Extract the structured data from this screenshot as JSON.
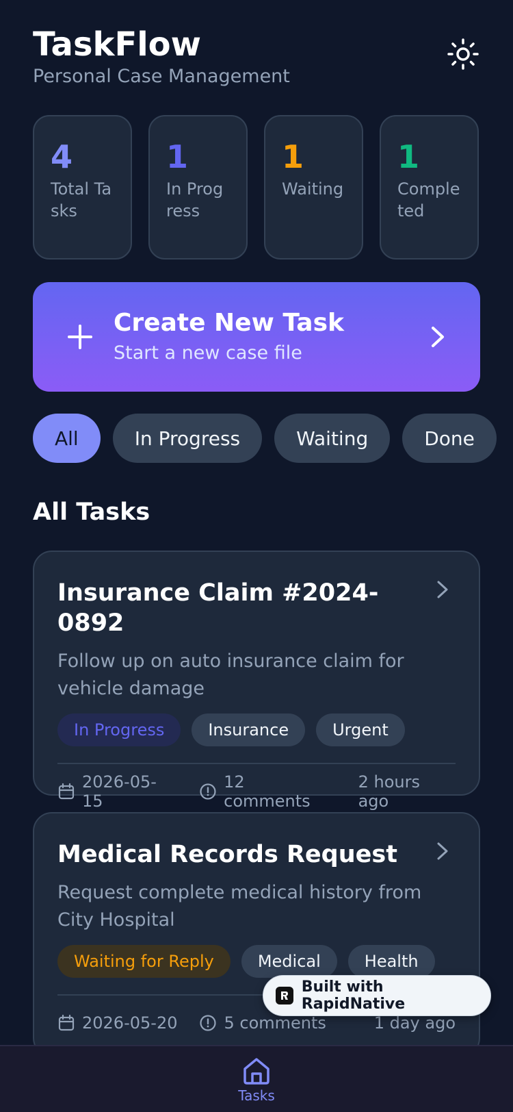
{
  "header": {
    "title": "TaskFlow",
    "subtitle": "Personal Case Management",
    "theme_icon": "sun-icon"
  },
  "stats": [
    {
      "value": "4",
      "label": "Total Tasks",
      "color": "#818cf8"
    },
    {
      "value": "1",
      "label": "In Progress",
      "color": "#6366f1"
    },
    {
      "value": "1",
      "label": "Waiting",
      "color": "#f59e0b"
    },
    {
      "value": "1",
      "label": "Completed",
      "color": "#10b981"
    }
  ],
  "create": {
    "title": "Create New Task",
    "subtitle": "Start a new case file",
    "gradient_start": "#6366f1",
    "gradient_end": "#8b5cf6"
  },
  "filters": [
    {
      "label": "All",
      "active": true
    },
    {
      "label": "In Progress",
      "active": false
    },
    {
      "label": "Waiting",
      "active": false
    },
    {
      "label": "Done",
      "active": false
    }
  ],
  "section": {
    "title": "All Tasks"
  },
  "tasks": [
    {
      "title": "Insurance Claim #2024-0892",
      "description": "Follow up on auto insurance claim for vehicle damage",
      "status": "In Progress",
      "tags": [
        "Insurance",
        "Urgent"
      ],
      "date": "2026-05-15",
      "comments": "12 comments",
      "time": "2 hours ago"
    },
    {
      "title": "Medical Records Request",
      "description": "Request complete medical history from City Hospital",
      "status": "Waiting for Reply",
      "tags": [
        "Medical",
        "Health"
      ],
      "date": "2026-05-20",
      "comments": "5 comments",
      "time": "1 day ago"
    }
  ],
  "badge": {
    "text": "Built with RapidNative"
  },
  "nav": {
    "tasks_label": "Tasks",
    "accent": "#818cf8"
  }
}
